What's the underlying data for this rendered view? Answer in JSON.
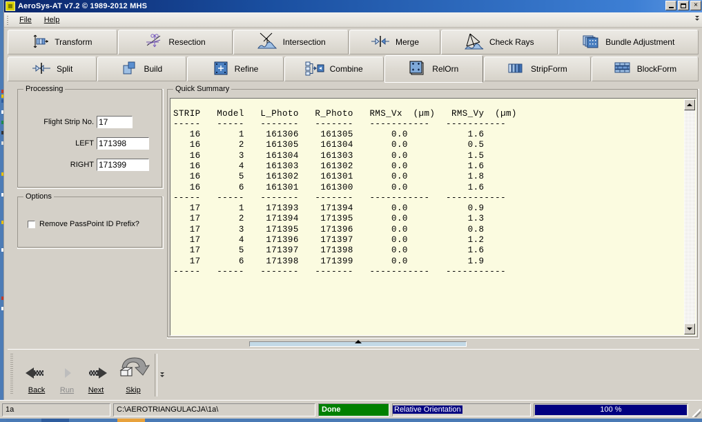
{
  "window": {
    "title": "AeroSys-AT  v7.2 © 1989-2012 MHS",
    "icon": "app-icon",
    "buttons": {
      "minimize": "_",
      "maximize": "□",
      "close": "×"
    }
  },
  "menu": {
    "items": [
      "File",
      "Help"
    ],
    "overflow": "⇱"
  },
  "toolbar": {
    "row1": [
      {
        "label": "Transform",
        "icon": "transform-icon",
        "active": false
      },
      {
        "label": "Resection",
        "icon": "resection-icon",
        "active": false
      },
      {
        "label": "Intersection",
        "icon": "intersection-icon",
        "active": false
      },
      {
        "label": "Merge",
        "icon": "merge-icon",
        "active": false
      },
      {
        "label": "Check Rays",
        "icon": "checkrays-icon",
        "active": false
      },
      {
        "label": "Bundle Adjustment",
        "icon": "bundle-icon",
        "active": false
      }
    ],
    "row2": [
      {
        "label": "Split",
        "icon": "split-icon",
        "active": false
      },
      {
        "label": "Build",
        "icon": "build-icon",
        "active": false
      },
      {
        "label": "Refine",
        "icon": "refine-icon",
        "active": false
      },
      {
        "label": "Combine",
        "icon": "combine-icon",
        "active": false
      },
      {
        "label": "RelOrn",
        "icon": "relorn-icon",
        "active": true
      },
      {
        "label": "StripForm",
        "icon": "stripform-icon",
        "active": false
      },
      {
        "label": "BlockForm",
        "icon": "blockform-icon",
        "active": false
      }
    ]
  },
  "processing": {
    "title": "Processing",
    "fields": [
      {
        "label": "Flight Strip No.",
        "value": "17"
      },
      {
        "label": "LEFT",
        "value": "171398"
      },
      {
        "label": "RIGHT",
        "value": "171399"
      }
    ]
  },
  "options": {
    "title": "Options",
    "checkbox": {
      "label": "Remove PassPoint ID Prefix?",
      "checked": false
    }
  },
  "summary": {
    "title": "Quick Summary",
    "columns": [
      "STRIP",
      "Model",
      "L_Photo",
      "R_Photo",
      "RMS_Vx  (µm)",
      "RMS_Vy  (µm)"
    ],
    "rule": [
      "-----",
      "-----",
      "-------",
      "-------",
      "-----------",
      "-----------"
    ],
    "rows": [
      [
        "16",
        "1",
        "161306",
        "161305",
        "0.0",
        "1.6"
      ],
      [
        "16",
        "2",
        "161305",
        "161304",
        "0.0",
        "0.5"
      ],
      [
        "16",
        "3",
        "161304",
        "161303",
        "0.0",
        "1.5"
      ],
      [
        "16",
        "4",
        "161303",
        "161302",
        "0.0",
        "1.6"
      ],
      [
        "16",
        "5",
        "161302",
        "161301",
        "0.0",
        "1.8"
      ],
      [
        "16",
        "6",
        "161301",
        "161300",
        "0.0",
        "1.6"
      ],
      [
        "-",
        "-",
        "-",
        "-",
        "-",
        "-"
      ],
      [
        "17",
        "1",
        "171393",
        "171394",
        "0.0",
        "0.9"
      ],
      [
        "17",
        "2",
        "171394",
        "171395",
        "0.0",
        "1.3"
      ],
      [
        "17",
        "3",
        "171395",
        "171396",
        "0.0",
        "0.8"
      ],
      [
        "17",
        "4",
        "171396",
        "171397",
        "0.0",
        "1.2"
      ],
      [
        "17",
        "5",
        "171397",
        "171398",
        "0.0",
        "1.6"
      ],
      [
        "17",
        "6",
        "171398",
        "171399",
        "0.0",
        "1.9"
      ],
      [
        "-",
        "-",
        "-",
        "-",
        "-",
        "-"
      ]
    ],
    "text": "STRIP   Model   L_Photo   R_Photo   RMS_Vx  (µm)   RMS_Vy  (µm)\n-----   -----   -------   -------   -----------   -----------\n   16       1    161306    161305       0.0           1.6\n   16       2    161305    161304       0.0           0.5\n   16       3    161304    161303       0.0           1.5\n   16       4    161303    161302       0.0           1.6\n   16       5    161302    161301       0.0           1.8\n   16       6    161301    161300       0.0           1.6\n-----   -----   -------   -------   -----------   -----------\n   17       1    171393    171394       0.0           0.9\n   17       2    171394    171395       0.0           1.3\n   17       3    171395    171396       0.0           0.8\n   17       4    171396    171397       0.0           1.2\n   17       5    171397    171398       0.0           1.6\n   17       6    171398    171399       0.0           1.9\n-----   -----   -------   -------   -----------   -----------"
  },
  "navigation": {
    "buttons": [
      {
        "label": "Back",
        "icon": "arrow-left-icon",
        "enabled": true
      },
      {
        "label": "Run",
        "icon": "arrow-right-small-icon",
        "enabled": false
      },
      {
        "label": "Next",
        "icon": "arrow-right-icon",
        "enabled": true
      },
      {
        "label": "Skip",
        "icon": "skip-arrow-icon",
        "enabled": true
      }
    ],
    "overflow": "⇱"
  },
  "status": {
    "project": "1a",
    "path": "C:\\AEROTRIANGULACJA\\1a\\",
    "state": "Done",
    "mode": "Relative Orientation",
    "progress_text": "100 %",
    "progress_percent": 100
  },
  "colors": {
    "titlebar_start": "#0a246a",
    "titlebar_end": "#5a94e0",
    "face": "#d4d0c8",
    "summary_bg": "#fbfbe0",
    "done_green": "#008000",
    "progress_navy": "#000080",
    "desktop": "#4a7ab5"
  }
}
